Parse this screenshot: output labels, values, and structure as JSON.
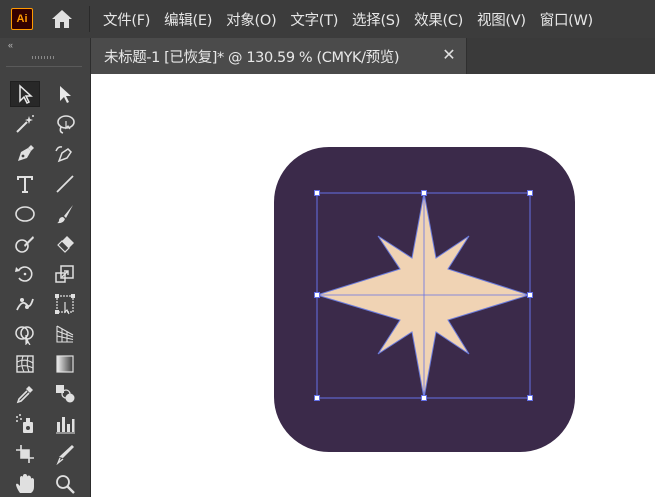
{
  "app": {
    "logo_text": "Ai"
  },
  "menu": [
    {
      "label": "文件(F)"
    },
    {
      "label": "编辑(E)"
    },
    {
      "label": "对象(O)"
    },
    {
      "label": "文字(T)"
    },
    {
      "label": "选择(S)"
    },
    {
      "label": "效果(C)"
    },
    {
      "label": "视图(V)"
    },
    {
      "label": "窗口(W)"
    }
  ],
  "toolbar": {
    "collapse_glyph": "«"
  },
  "tabs": [
    {
      "title": "未标题-1 [已恢复]* @ 130.59 % (CMYK/预览)",
      "close_glyph": "✕"
    }
  ],
  "tools": [
    {
      "name": "selection-tool-icon",
      "active": true
    },
    {
      "name": "direct-selection-tool-icon"
    },
    {
      "name": "magic-wand-tool-icon"
    },
    {
      "name": "lasso-tool-icon"
    },
    {
      "name": "pen-tool-icon"
    },
    {
      "name": "curvature-tool-icon"
    },
    {
      "name": "type-tool-icon"
    },
    {
      "name": "line-segment-tool-icon"
    },
    {
      "name": "ellipse-tool-icon"
    },
    {
      "name": "paintbrush-tool-icon"
    },
    {
      "name": "shaper-tool-icon"
    },
    {
      "name": "eraser-tool-icon"
    },
    {
      "name": "rotate-tool-icon"
    },
    {
      "name": "scale-tool-icon"
    },
    {
      "name": "puppet-warp-tool-icon"
    },
    {
      "name": "free-transform-tool-icon"
    },
    {
      "name": "shape-builder-tool-icon"
    },
    {
      "name": "perspective-grid-tool-icon"
    },
    {
      "name": "mesh-tool-icon"
    },
    {
      "name": "gradient-tool-icon"
    },
    {
      "name": "eyedropper-tool-icon"
    },
    {
      "name": "blend-tool-icon"
    },
    {
      "name": "symbol-sprayer-tool-icon"
    },
    {
      "name": "column-graph-tool-icon"
    },
    {
      "name": "artboard-tool-icon"
    },
    {
      "name": "slice-tool-icon"
    },
    {
      "name": "hand-tool-icon"
    },
    {
      "name": "zoom-tool-icon"
    }
  ],
  "artwork": {
    "background_color": "#3b2a4a",
    "star_fill": "#f0d3b4",
    "star_stroke": "#6b7bdc",
    "selection_color": "#6470e6"
  }
}
